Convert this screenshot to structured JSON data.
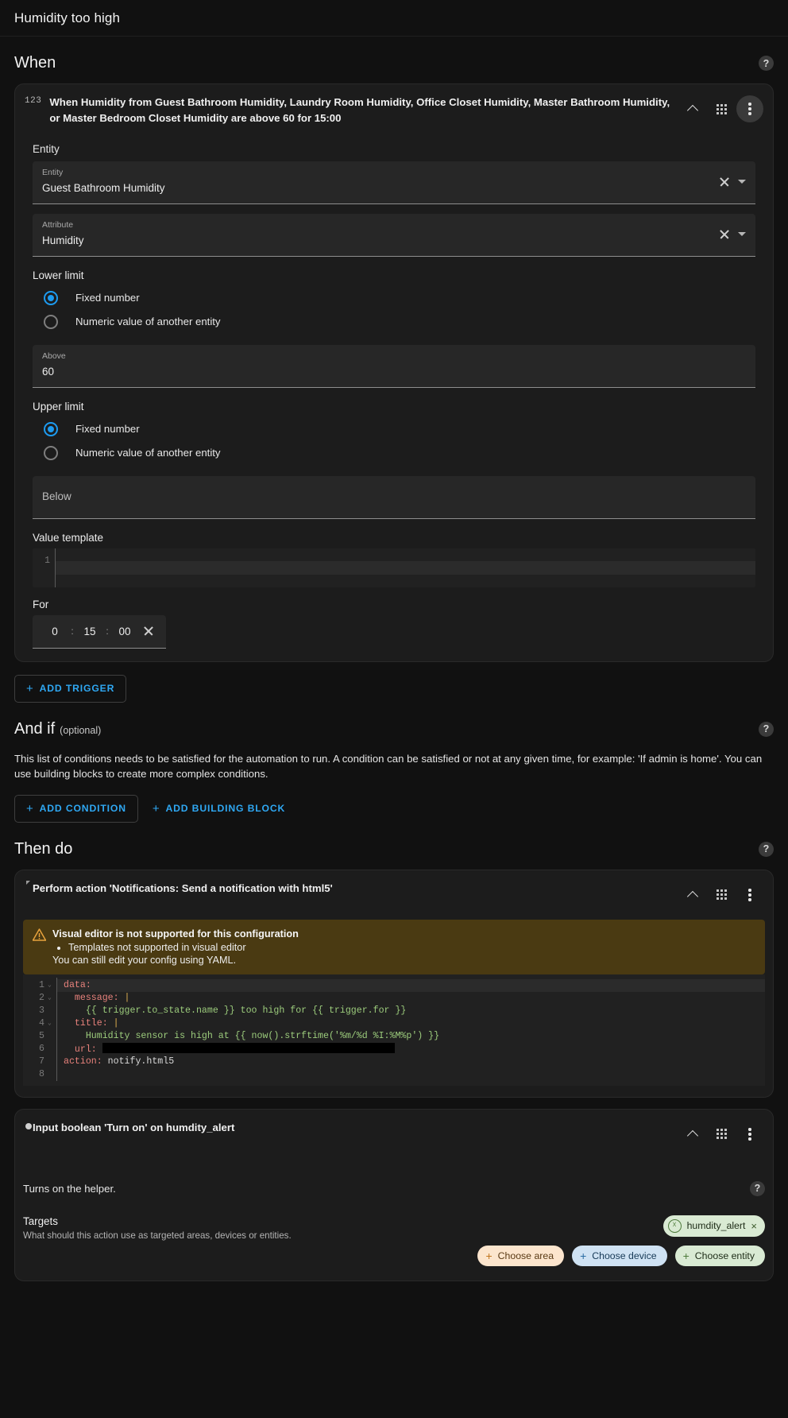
{
  "topbar": {
    "title": "Humidity too high"
  },
  "sections": {
    "when": {
      "title": "When",
      "help": "?"
    },
    "andif": {
      "title": "And if",
      "optional": "(optional)",
      "help": "?",
      "description": "This list of conditions needs to be satisfied for the automation to run. A condition can be satisfied or not at any given time, for example: 'If admin is home'. You can use building blocks to create more complex conditions."
    },
    "thendo": {
      "title": "Then do",
      "help": "?"
    }
  },
  "trigger": {
    "badge": "123",
    "title": "When Humidity from Guest Bathroom Humidity, Laundry Room Humidity, Office Closet Humidity, Master Bathroom Humidity, or Master Bedroom Closet Humidity are above 60 for 15:00",
    "entity_section_label": "Entity",
    "entity_field": {
      "caption": "Entity",
      "value": "Guest Bathroom Humidity"
    },
    "attribute_field": {
      "caption": "Attribute",
      "value": "Humidity"
    },
    "lower_limit": {
      "label": "Lower limit",
      "options": [
        {
          "label": "Fixed number",
          "checked": true
        },
        {
          "label": "Numeric value of another entity",
          "checked": false
        }
      ],
      "field": {
        "caption": "Above",
        "value": "60"
      }
    },
    "upper_limit": {
      "label": "Upper limit",
      "options": [
        {
          "label": "Fixed number",
          "checked": true
        },
        {
          "label": "Numeric value of another entity",
          "checked": false
        }
      ],
      "field": {
        "caption": "Below",
        "value": ""
      }
    },
    "value_template": {
      "label": "Value template",
      "line_number": "1",
      "value": ""
    },
    "for": {
      "label": "For",
      "hours": "0",
      "minutes": "15",
      "seconds": "00",
      "sep": ":"
    },
    "add_trigger_label": "ADD TRIGGER"
  },
  "conditions": {
    "add_condition_label": "ADD CONDITION",
    "add_building_block_label": "ADD BUILDING BLOCK"
  },
  "action_notify": {
    "title": "Perform action 'Notifications: Send a notification with html5'",
    "warning": {
      "title": "Visual editor is not supported for this configuration",
      "bullets": [
        "Templates not supported in visual editor"
      ],
      "footer": "You can still edit your config using YAML."
    },
    "yaml_lines": [
      {
        "n": "1",
        "fold": true,
        "segments": [
          {
            "t": "data:",
            "c": "y-key"
          }
        ]
      },
      {
        "n": "2",
        "fold": true,
        "segments": [
          {
            "t": "  message: ",
            "c": "y-key"
          },
          {
            "t": "|",
            "c": "y-pipe"
          }
        ]
      },
      {
        "n": "3",
        "fold": false,
        "segments": [
          {
            "t": "    {{ trigger.to_state.name }} too high for {{ trigger.for }}",
            "c": "y-str"
          }
        ]
      },
      {
        "n": "4",
        "fold": true,
        "segments": [
          {
            "t": "  title: ",
            "c": "y-key"
          },
          {
            "t": "|",
            "c": "y-pipe"
          }
        ]
      },
      {
        "n": "5",
        "fold": false,
        "segments": [
          {
            "t": "    Humidity sensor is high at {{ now().strftime('%m/%d %I:%M%p') }}",
            "c": "y-str"
          }
        ]
      },
      {
        "n": "6",
        "fold": false,
        "segments": [
          {
            "t": "  url: ",
            "c": "y-key"
          },
          {
            "t": "",
            "c": "redacted"
          }
        ]
      },
      {
        "n": "7",
        "fold": false,
        "segments": [
          {
            "t": "action: ",
            "c": "y-key"
          },
          {
            "t": "notify.html5",
            "c": "y-plain"
          }
        ]
      },
      {
        "n": "8",
        "fold": false,
        "segments": []
      }
    ]
  },
  "action_helper": {
    "title": "Input boolean 'Turn on' on humdity_alert",
    "description": "Turns on the helper.",
    "help": "?",
    "targets": {
      "title": "Targets",
      "subtitle": "What should this action use as targeted areas, devices or entities.",
      "chip": {
        "label": "humdity_alert",
        "close": "×"
      },
      "buttons": [
        {
          "label": "Choose area",
          "plus": "+",
          "style": "pick-area"
        },
        {
          "label": "Choose device",
          "plus": "+",
          "style": "pick-device"
        },
        {
          "label": "Choose entity",
          "plus": "+",
          "style": "pick-entity"
        }
      ]
    }
  },
  "colors": {
    "accent": "#2fa8f3",
    "radio": "#1d9bf0",
    "warning_bg": "#4a3a12",
    "warning_icon": "#e8a33d"
  }
}
